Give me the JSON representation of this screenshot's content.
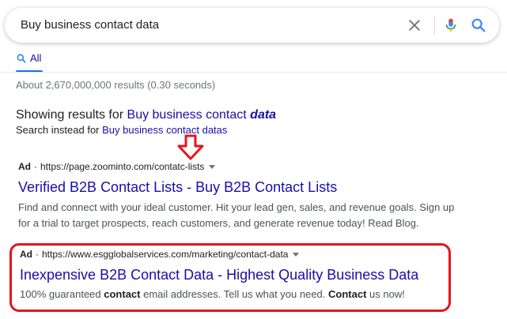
{
  "search": {
    "query": "Buy business contact data",
    "icons": {
      "clear": "close-icon",
      "voice": "microphone-icon",
      "submit": "search-icon"
    }
  },
  "tabs": [
    {
      "label": "All",
      "icon": "search-icon",
      "active": true
    }
  ],
  "stats": "About 2,670,000,000 results (0.30 seconds)",
  "correction": {
    "showing_prefix": "Showing results for",
    "showing_query_plain": "Buy business contact",
    "showing_query_corrected": "data",
    "instead_prefix": "Search instead for",
    "instead_query": "Buy business contact datas"
  },
  "ads": [
    {
      "badge": "Ad",
      "separator": "·",
      "url": "https://page.zoominto.com/contatc-lists",
      "title": "Verified B2B Contact Lists - Buy B2B Contact Lists",
      "desc_line1": "Find and connect with your ideal customer. Hit your lead gen, sales, and revenue goals. Sign up",
      "desc_line2": "for a trial to target prospects, reach customers, and generate revenue today! Read Blog."
    },
    {
      "badge": "Ad",
      "separator": "·",
      "url": "https://www.esgglobalservices.com/marketing/contact-data",
      "title": "Inexpensive B2B Contact Data - Highest Quality Business Data",
      "desc_part1": "100% guaranteed ",
      "desc_bold1": "contact",
      "desc_part2": " email addresses. Tell us what you need. ",
      "desc_bold2": "Contact",
      "desc_part3": " us now!"
    }
  ],
  "annotations": {
    "arrow_color": "#e8141c",
    "highlight_color": "#e8141c"
  },
  "colors": {
    "link": "#1a0dab",
    "accent": "#1a73e8",
    "muted": "#70757a"
  }
}
